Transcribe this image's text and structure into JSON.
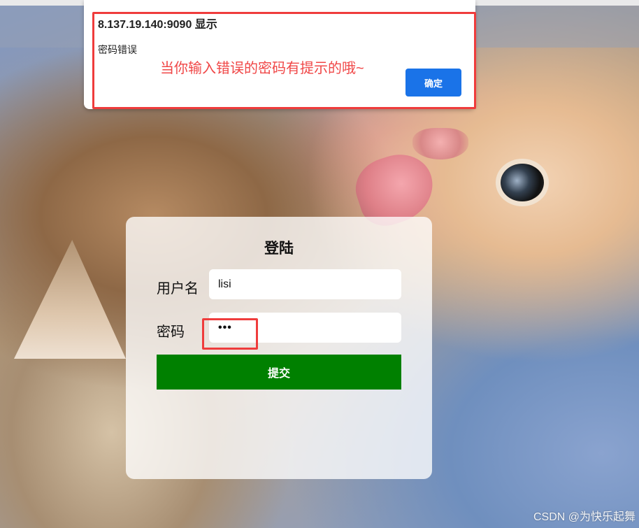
{
  "alert": {
    "title": "8.137.19.140:9090 显示",
    "message": "密码错误",
    "confirm_label": "确定"
  },
  "annotation": {
    "text": "当你输入错误的密码有提示的哦~",
    "color": "#f04747"
  },
  "login": {
    "title": "登陆",
    "username_label": "用户名",
    "username_value": "lisi",
    "password_label": "密码",
    "password_value": "•••",
    "submit_label": "提交",
    "submit_color": "#008000"
  },
  "watermark": {
    "text": "CSDN @为快乐起舞"
  },
  "icons": {
    "background_image": "kittens-background"
  }
}
